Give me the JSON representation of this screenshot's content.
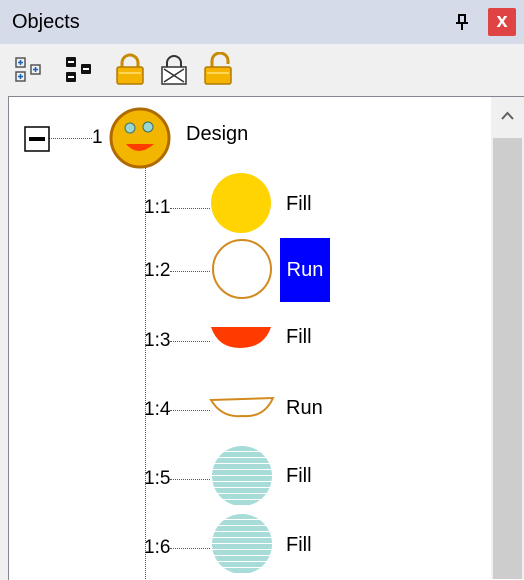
{
  "window": {
    "title": "Objects",
    "close_symbol": "x"
  },
  "toolbar": {
    "buttons": [
      {
        "name": "expand-all-icon"
      },
      {
        "name": "collapse-all-icon"
      },
      {
        "name": "lock-icon"
      },
      {
        "name": "lock-crossed-icon"
      },
      {
        "name": "unlock-icon"
      }
    ]
  },
  "tree": {
    "root": {
      "number": "1",
      "label": "Design",
      "expanded": true
    },
    "children": [
      {
        "number": "1:1",
        "label": "Fill",
        "shape": "yellow-circle",
        "selected": false
      },
      {
        "number": "1:2",
        "label": "Run",
        "shape": "outline-circle",
        "selected": true
      },
      {
        "number": "1:3",
        "label": "Fill",
        "shape": "red-mouth",
        "selected": false
      },
      {
        "number": "1:4",
        "label": "Run",
        "shape": "outline-mouth",
        "selected": false
      },
      {
        "number": "1:5",
        "label": "Fill",
        "shape": "teal-striped-circle",
        "selected": false
      },
      {
        "number": "1:6",
        "label": "Fill",
        "shape": "teal-striped-circle",
        "selected": false
      }
    ]
  },
  "colors": {
    "selection": "#0000ff",
    "fill_yellow": "#ffd400",
    "outline_orange": "#d28a1e",
    "mouth_red": "#ff3b00",
    "teal": "#a7dcd9"
  }
}
